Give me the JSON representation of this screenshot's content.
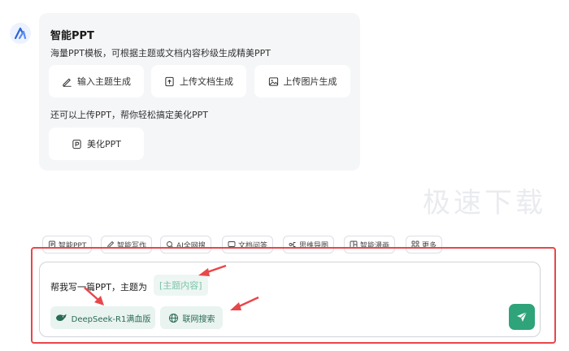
{
  "card": {
    "title": "智能PPT",
    "desc": "海量PPT模板，可根据主题或文档内容秒级生成精美PPT",
    "options": [
      {
        "label": "输入主题生成",
        "icon": "pencil-icon"
      },
      {
        "label": "上传文档生成",
        "icon": "upload-document-icon"
      },
      {
        "label": "上传图片生成",
        "icon": "image-icon"
      }
    ],
    "desc2": "还可以上传PPT，帮你轻松搞定美化PPT",
    "beautify_label": "美化PPT"
  },
  "watermark": "极速下载",
  "tools": [
    {
      "label": "智能PPT",
      "icon": "ppt-icon"
    },
    {
      "label": "智能写作",
      "icon": "pen-icon"
    },
    {
      "label": "AI全网搜",
      "icon": "search-icon"
    },
    {
      "label": "文档问答",
      "icon": "doc-chat-icon"
    },
    {
      "label": "思维导图",
      "icon": "mindmap-icon"
    },
    {
      "label": "智能漫画",
      "icon": "comic-icon"
    },
    {
      "label": "更多",
      "icon": "grid-icon"
    }
  ],
  "input": {
    "prompt_text": "帮我写一篇PPT，主题为",
    "placeholder_tag": "[主题内容]",
    "model_label": "DeepSeek-R1满血版",
    "search_label": "联网搜索"
  },
  "colors": {
    "accent": "#2fa37a",
    "highlight": "#e8474a",
    "card_bg": "#f5f6f8"
  }
}
